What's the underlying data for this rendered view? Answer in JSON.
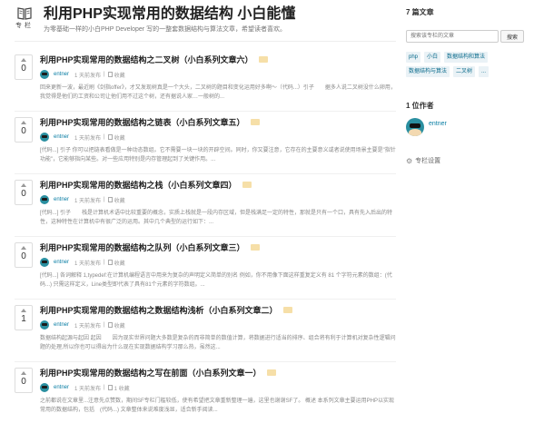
{
  "header": {
    "logo_text": "专栏",
    "title": "利用PHP实现常用的数据结构 小白能懂",
    "description": "为零基础一样的小白PHP Developer 写的一整套数据结构与算法文章，希望读者喜欢。"
  },
  "articles": [
    {
      "votes": "0",
      "title": "利用PHP实现常用的数据结构之二叉树（小白系列文章六）",
      "author": "entner",
      "time": "1 天前发布",
      "bookmark": "收藏",
      "excerpt": "回来更新一波，最近刷《剑指offer》，才又发现树真是一个大头，二叉树的题目和变化运用好多啊～（代码...）引子　　据多人说二叉树没什么卵用，我觉得是他们的工资和公司让他们用不过这个树，还有据说人家…一般树的..."
    },
    {
      "votes": "0",
      "title": "利用PHP实现常用的数据结构之链表（小白系列文章五）",
      "author": "entner",
      "time": "1 天前发布",
      "bookmark": "收藏",
      "excerpt": "[代码...] 引子 你可以把链表看做是一种动态数组。它不需要一块一块的开辟空间。同时，你又要注意，它存在的主要意义或者说使用场景主要是\"指针功能\"，它能够指向某些。对一些应用特别是内存管理起到了关键作用。..."
    },
    {
      "votes": "0",
      "title": "利用PHP实现常用的数据结构之栈（小白系列文章四）",
      "author": "entner",
      "time": "1 天前发布",
      "bookmark": "收藏",
      "excerpt": "[代码...] 引子　　栈是计算机术语中比较重要的概念，实质上栈就是一段内存区域，但是栈满足一定的特性，那就是只有一个口，具有先入后出的特性，这种特性在计算机中有很广泛的运用。其中几个典型的运行如下：..."
    },
    {
      "votes": "0",
      "title": "利用PHP实现常用的数据结构之队列（小白系列文章三）",
      "author": "entner",
      "time": "1 天前发布",
      "bookmark": "收藏",
      "excerpt": "[代码...] 各词解释 1,typedef:在计算机编程语言中用来为复杂的声明定义简单的别名 例如，你不用像下面这样重复定义有 81 个字符元素的数组：(代码...) 只需这样定义，Line类型即代表了具有81个元素的字符数组。..."
    },
    {
      "votes": "1",
      "title": "利用PHP实现常用的数据结构之数据结构浅析（小白系列文章二）",
      "author": "entner",
      "time": "1 天前发布",
      "bookmark": "收藏",
      "excerpt": "数据结构起源与起因 起因　　因为现实世界问题大多数是复杂的而非简单的数值计算，将数据进行适当的排序、组合将有利于计算机对复杂性逻辑问题的处理,所以你也可以得出为什么现在实现数据结构学习那么热，虽然这..."
    },
    {
      "votes": "0",
      "title": "利用PHP实现常用的数据结构之写在前面（小白系列文章一）",
      "author": "entner",
      "time": "1 天前发布",
      "bookmark": "1 收藏",
      "excerpt": "之前都说在文章里...注意先点赞数，期间SF专栏门槛较低，使有希望把文章重新整理一遍，这里也谢谢SF了。 概述 本系列文章主要运用PHP以实现常用的数据结构，包括　(代码...) 文章整体来说难度浅显，适合新手阅读..."
    }
  ],
  "sidebar": {
    "article_count": "7 篇文章",
    "search_placeholder": "搜索该专栏的文章",
    "search_button": "搜索",
    "tags": [
      "php",
      "小白",
      "数据结构和算法",
      "数据结构与算法",
      "二叉树",
      "..."
    ],
    "authors_heading": "1 位作者",
    "author_name": "entner",
    "settings_label": "专栏设置"
  },
  "colors": {
    "accent": "#0a7ea4",
    "tag_bg": "#f6dfa8",
    "avatar": "#2a8fa0"
  }
}
